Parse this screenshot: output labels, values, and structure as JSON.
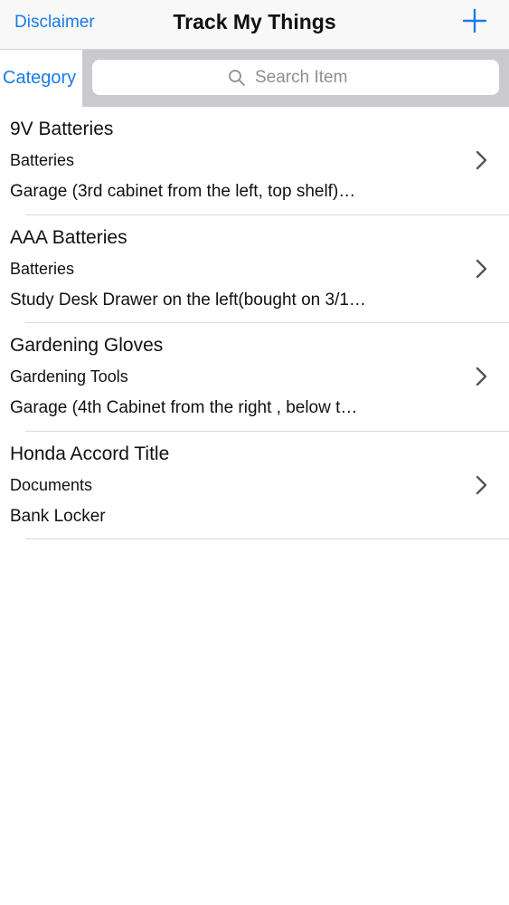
{
  "navbar": {
    "left_label": "Disclaimer",
    "title": "Track My Things",
    "add_icon": "plus-icon"
  },
  "search": {
    "category_label": "Category",
    "placeholder": "Search Item",
    "icon": "search-icon"
  },
  "items": [
    {
      "title": "9V Batteries",
      "category": "Batteries",
      "location": "Garage (3rd cabinet from the left, top shelf)…"
    },
    {
      "title": "AAA Batteries",
      "category": "Batteries",
      "location": "Study Desk Drawer on the left(bought on 3/1…"
    },
    {
      "title": "Gardening Gloves",
      "category": "Gardening Tools",
      "location": "Garage  (4th Cabinet from the right , below t…"
    },
    {
      "title": "Honda Accord Title",
      "category": "Documents",
      "location": "Bank Locker"
    }
  ],
  "colors": {
    "accent": "#1a7be6",
    "search_bar_bg": "#c9c9ce"
  }
}
